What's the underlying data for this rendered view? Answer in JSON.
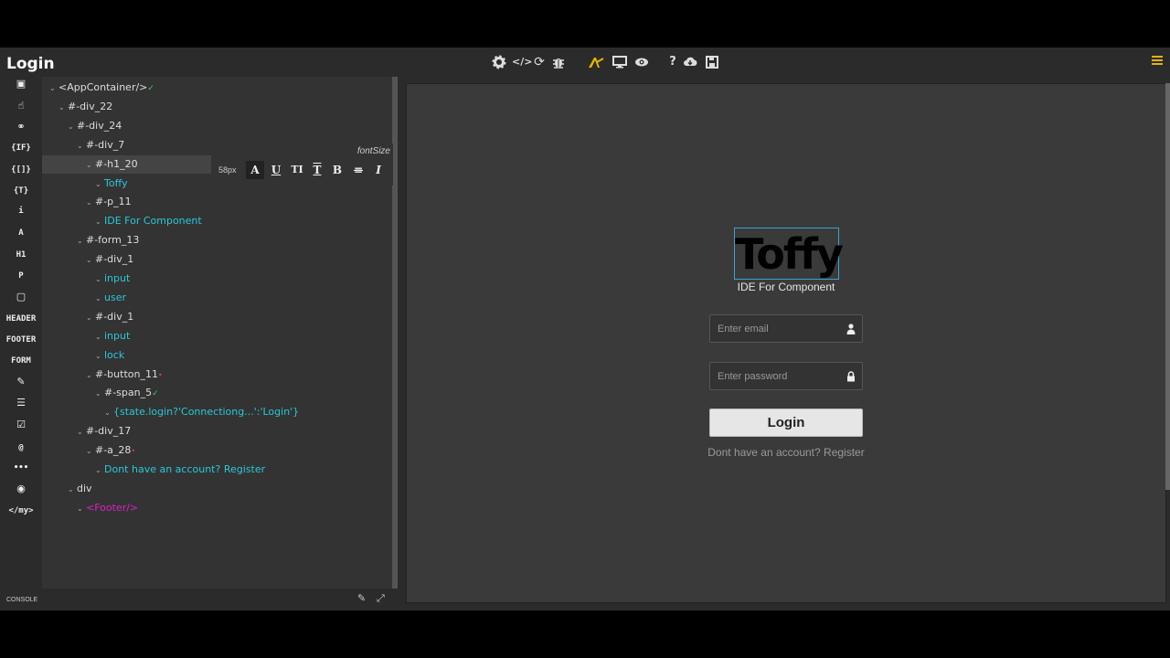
{
  "app": {
    "title": "Login"
  },
  "toolbar": {
    "icons": [
      "gear-icon",
      "code-icon",
      "refresh-icon",
      "bug-icon",
      "magic-icon",
      "desktop-icon",
      "eye-icon",
      "help-icon",
      "cloud-download-icon",
      "save-icon"
    ],
    "accent": "#e8b400"
  },
  "rail": {
    "items": [
      {
        "name": "image-icon",
        "label": ""
      },
      {
        "name": "hand-pointer-icon",
        "label": ""
      },
      {
        "name": "link-icon",
        "label": ""
      },
      {
        "name": "if-block",
        "label": "{IF}"
      },
      {
        "name": "loop-block",
        "label": "{[]}"
      },
      {
        "name": "text-block",
        "label": "{T}"
      },
      {
        "name": "italic-icon",
        "label": "i"
      },
      {
        "name": "font-icon",
        "label": "A"
      },
      {
        "name": "h1-element",
        "label": "H1"
      },
      {
        "name": "p-element",
        "label": "P"
      },
      {
        "name": "square-icon",
        "label": ""
      },
      {
        "name": "header-element",
        "label": "HEADER"
      },
      {
        "name": "footer-element",
        "label": "FOOTER"
      },
      {
        "name": "form-element",
        "label": "FORM"
      },
      {
        "name": "edit-icon",
        "label": ""
      },
      {
        "name": "list-icon",
        "label": ""
      },
      {
        "name": "checkbox-icon",
        "label": ""
      },
      {
        "name": "at-icon",
        "label": "@"
      },
      {
        "name": "more-icon",
        "label": "•••"
      },
      {
        "name": "radio-icon",
        "label": ""
      },
      {
        "name": "custom-component",
        "label": "</my>"
      }
    ]
  },
  "tree": {
    "nodes": [
      {
        "indent": 0,
        "label": "<AppContainer/>",
        "kind": "node",
        "mark": "✓"
      },
      {
        "indent": 1,
        "label": "#-div_22",
        "kind": "node"
      },
      {
        "indent": 2,
        "label": "#-div_24",
        "kind": "node"
      },
      {
        "indent": 3,
        "label": "#-div_7",
        "kind": "node"
      },
      {
        "indent": 4,
        "label": "#-h1_20",
        "kind": "node",
        "selected": true
      },
      {
        "indent": 5,
        "label": "Toffy",
        "kind": "text"
      },
      {
        "indent": 4,
        "label": "#-p_11",
        "kind": "node"
      },
      {
        "indent": 5,
        "label": "IDE For Component",
        "kind": "text"
      },
      {
        "indent": 3,
        "label": "#-form_13",
        "kind": "node"
      },
      {
        "indent": 4,
        "label": "#-div_1",
        "kind": "node"
      },
      {
        "indent": 5,
        "label": "input",
        "kind": "text"
      },
      {
        "indent": 5,
        "label": "user",
        "kind": "text"
      },
      {
        "indent": 4,
        "label": "#-div_1",
        "kind": "node"
      },
      {
        "indent": 5,
        "label": "input",
        "kind": "text"
      },
      {
        "indent": 5,
        "label": "lock",
        "kind": "text"
      },
      {
        "indent": 4,
        "label": "#-button_11",
        "kind": "node",
        "red": "•"
      },
      {
        "indent": 5,
        "label": "#-span_5",
        "kind": "node",
        "mark": "✓"
      },
      {
        "indent": 6,
        "label": "{state.login?'Connectiong...':'Login'}",
        "kind": "text"
      },
      {
        "indent": 3,
        "label": "#-div_17",
        "kind": "node"
      },
      {
        "indent": 4,
        "label": "#-a_28",
        "kind": "node",
        "red": "•"
      },
      {
        "indent": 5,
        "label": "Dont have an account? Register",
        "kind": "text"
      },
      {
        "indent": 2,
        "label": "div",
        "kind": "node"
      },
      {
        "indent": 3,
        "label": "<Footer/>",
        "kind": "tag"
      }
    ]
  },
  "fontbar": {
    "title": "fontSize",
    "size": "58px",
    "buttons": [
      "A",
      "U",
      "TI",
      "T",
      "B",
      "≡",
      "I"
    ]
  },
  "console": {
    "label": "CONSOLE"
  },
  "preview": {
    "brand": "Toffy",
    "subtitle": "IDE For Component",
    "email_placeholder": "Enter email",
    "password_placeholder": "Enter password",
    "login_label": "Login",
    "register_text": "Dont have an account? Register"
  }
}
